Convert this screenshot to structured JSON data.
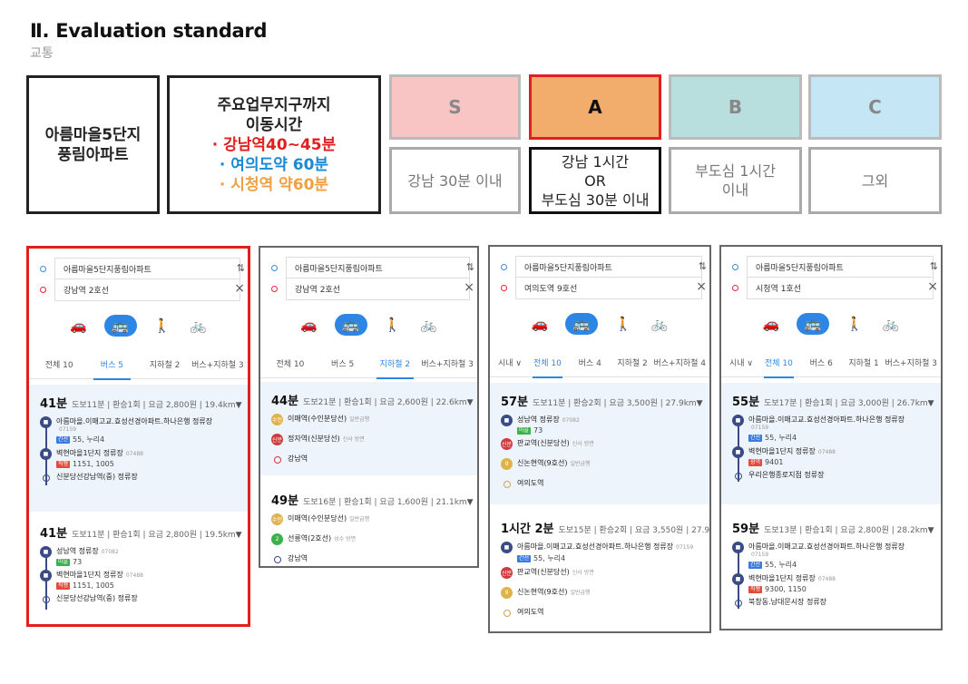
{
  "header": {
    "title": "Ⅱ. Evaluation standard",
    "subtitle": "교통"
  },
  "apartment": {
    "line1": "아름마을5단지",
    "line2": "풍림아파트"
  },
  "commute": {
    "title1": "주요업무지구까지",
    "title2": "이동시간",
    "gangnam": "· 강남역40~45분",
    "yeouido": "· 여의도약 60분",
    "cityhall": "· 시청역 약60분"
  },
  "colors": {
    "red": "#e02020",
    "blue": "#1a8ad4",
    "orange": "#f0a040",
    "s": "#f8c4c4",
    "a": "#f2ad6c",
    "b": "#b9dede",
    "c": "#c4e6f5"
  },
  "grades": [
    {
      "label": "S",
      "desc1": "강남 30분 이내",
      "desc2": "",
      "desc3": ""
    },
    {
      "label": "A",
      "desc1": "강남 1시간",
      "desc2": "OR",
      "desc3": "부도심 30분 이내"
    },
    {
      "label": "B",
      "desc1": "부도심 1시간",
      "desc2": "이내",
      "desc3": ""
    },
    {
      "label": "C",
      "desc1": "그외",
      "desc2": "",
      "desc3": ""
    }
  ],
  "panels": [
    {
      "from": "아름마을5단지풍림아파트",
      "to": "강남역 2호선",
      "tabs": [
        "전체 10",
        "버스 5",
        "지하철 2",
        "버스+지하철 3"
      ],
      "r1": {
        "time": "41분",
        "info": "도보11분 | 환승1회 | 요금 2,800원 | 19.4km",
        "s1": "아름마을.이매고교.효성선경아파트.하나은행 정류장",
        "c1": "07159",
        "b1": "간선",
        "l1": "55, 누리4",
        "s2": "벽현마을1단지 정류장",
        "c2": "07488",
        "b2": "직행",
        "l2": "1151, 1005",
        "s3": "신분당선강남역(중) 정류장"
      },
      "r2": {
        "time": "41분",
        "info": "도보11분 | 환승1회 | 요금 2,800원 | 19.5km",
        "s1": "성남역 정류장",
        "c1": "07082",
        "b1": "마을",
        "l1": "73",
        "s2": "벽현마을1단지 정류장",
        "c2": "07488",
        "b2": "직행",
        "l2": "1151, 1005",
        "s3": "신분당선강남역(중) 정류장"
      }
    },
    {
      "from": "아름마을5단지풍림아파트",
      "to": "강남역 2호선",
      "tabs": [
        "전체 10",
        "버스 5",
        "지하철 2",
        "버스+지하철 3"
      ],
      "r1": {
        "time": "44분",
        "info": "도보21분 | 환승1회 | 요금 2,600원 | 22.6km",
        "s1": "이매역(수인분당선)",
        "c1": "일반급행",
        "ic1": "수인",
        "s2": "정자역(신분당선)",
        "c2": "신사 방면",
        "ic2": "신분",
        "s3": "강남역"
      },
      "r2": {
        "time": "49분",
        "info": "도보16분 | 환승1회 | 요금 1,600원 | 21.1km",
        "s1": "이매역(수인분당선)",
        "c1": "일반급행",
        "ic1": "수인",
        "s2": "선릉역(2호선)",
        "c2": "성수 방면",
        "ic2": "2",
        "s3": "강남역"
      }
    },
    {
      "from": "아름마을5단지풍림아파트",
      "to": "여의도역 9호선",
      "tabs": [
        "시내 ∨",
        "전체 10",
        "버스 4",
        "지하철 2",
        "버스+지하철 4"
      ],
      "r1": {
        "time": "57분",
        "info": "도보11분 | 환승2회 | 요금 3,500원 | 27.9km",
        "s1": "성남역 정류장",
        "c1": "07082",
        "b1": "마을",
        "l1": "73",
        "s2": "판교역(신분당선)",
        "c2": "신사 방면",
        "ic2": "신분",
        "s3": "신논현역(9호선)",
        "c3": "일반급행",
        "ic3": "9",
        "s4": "여의도역"
      },
      "r2": {
        "time": "1시간 2분",
        "info": "도보15분 | 환승2회 | 요금 3,550원 | 27.9km",
        "s1": "아름마을.이매고교.효성선경아파트.하나은행 정류장",
        "c1": "07159",
        "b1": "간선",
        "l1": "55, 누리4",
        "s2": "판교역(신분당선)",
        "c2": "신사 방면",
        "ic2": "신분",
        "s3": "신논현역(9호선)",
        "c3": "일반급행",
        "ic3": "9",
        "s4": "여의도역"
      }
    },
    {
      "from": "아름마을5단지풍림아파트",
      "to": "시청역 1호선",
      "tabs": [
        "시내 ∨",
        "전체 10",
        "버스 6",
        "지하철 1",
        "버스+지하철 3"
      ],
      "r1": {
        "time": "55분",
        "info": "도보17분 | 환승1회 | 요금 3,000원 | 26.7km",
        "s1": "아름마을.이매고교.효성선경아파트.하나은행 정류장",
        "c1": "07159",
        "b1": "간선",
        "l1": "55, 누리4",
        "s2": "벽현마을1단지 정류장",
        "c2": "07488",
        "b2": "광역",
        "l2": "9401",
        "s3": "우리은행종로지점 정류장"
      },
      "r2": {
        "time": "59분",
        "info": "도보13분 | 환승1회 | 요금 2,800원 | 28.2km",
        "s1": "아름마을.이매고교.효성선경아파트.하나은행 정류장",
        "c1": "07159",
        "b1": "간선",
        "l1": "55, 누리4",
        "s2": "벽현마을1단지 정류장",
        "c2": "07488",
        "b2": "직행",
        "l2": "9300, 1150",
        "s3": "북창동.남대문시장 정류장"
      }
    }
  ],
  "icons": {
    "car": "car-icon",
    "bus": "bus-icon",
    "walk": "walk-icon",
    "bike": "bike-icon"
  }
}
